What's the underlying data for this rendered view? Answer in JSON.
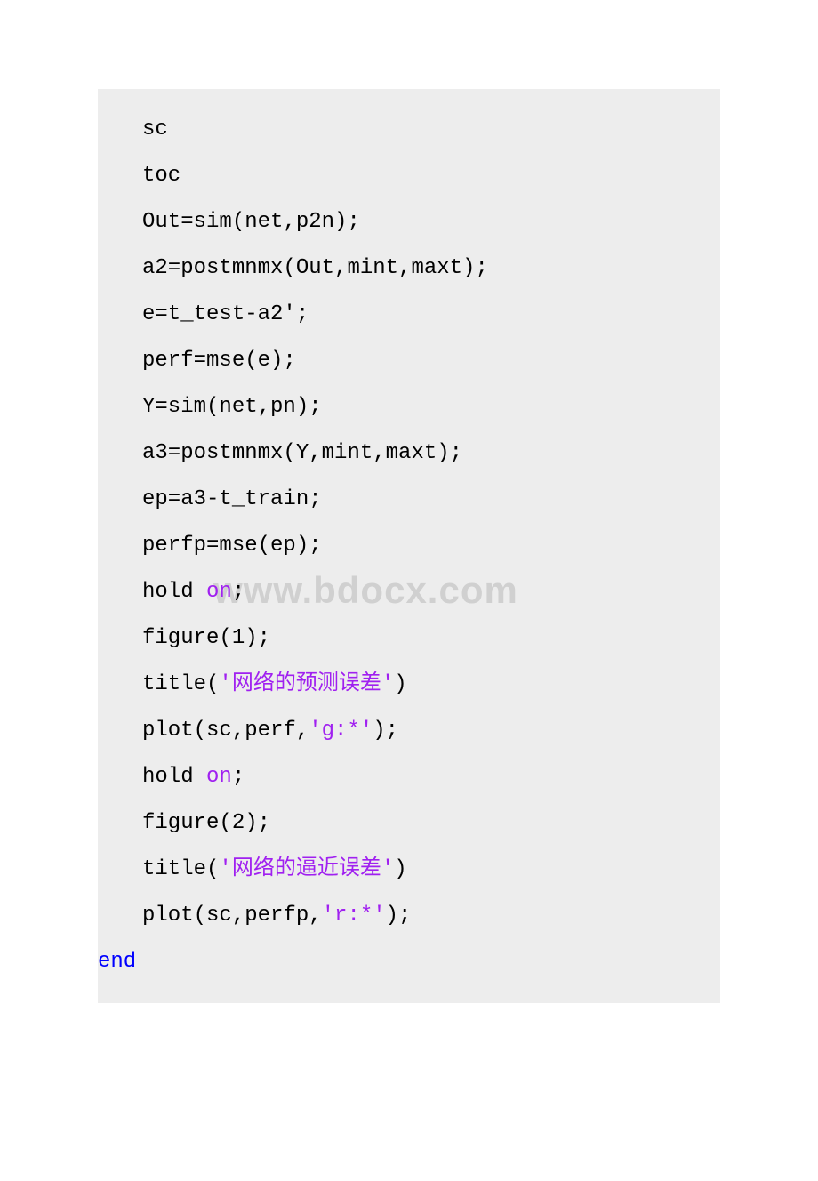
{
  "watermark": "www.bdocx.com",
  "code": {
    "l1": "sc",
    "l2": "toc",
    "l3": "Out=sim(net,p2n);",
    "l4": "a2=postmnmx(Out,mint,maxt);",
    "l5": "e=t_test-a2';",
    "l6": "perf=mse(e);",
    "l7": "Y=sim(net,pn);",
    "l8": "a3=postmnmx(Y,mint,maxt);",
    "l9": "ep=a3-t_train;",
    "l10": "perfp=mse(ep);",
    "l11a": "hold ",
    "l11b": "on",
    "l11c": ";",
    "l12": "figure(1);",
    "l13a": "title(",
    "l13b": "'网络的预测误差'",
    "l13c": ")",
    "l14a": "plot(sc,perf,",
    "l14b": "'g:*'",
    "l14c": ");",
    "l15a": "hold ",
    "l15b": "on",
    "l15c": ";",
    "l16": "figure(2);",
    "l17a": "title(",
    "l17b": "'网络的逼近误差'",
    "l17c": ")",
    "l18a": "plot(sc,perfp,",
    "l18b": "'r:*'",
    "l18c": ");",
    "l19": "end"
  }
}
